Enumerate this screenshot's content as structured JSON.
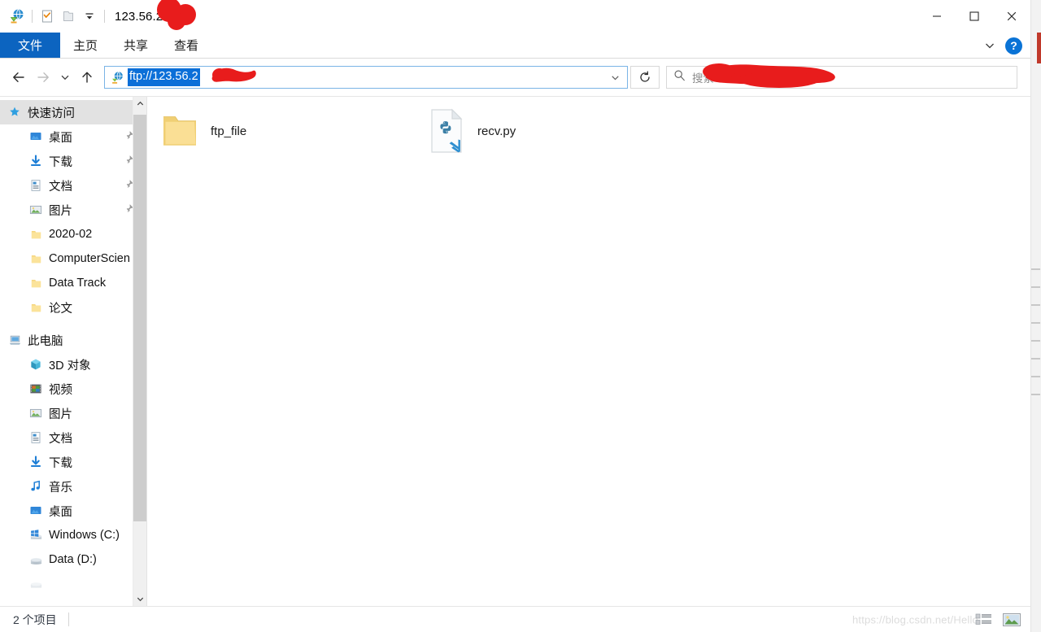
{
  "window": {
    "title": "123.56.2",
    "quick_access_toolbar": [
      {
        "name": "ftp-site-icon",
        "label": "FTP"
      },
      {
        "name": "properties-icon",
        "label": "属性"
      },
      {
        "name": "new-folder-icon",
        "label": "新建文件夹"
      },
      {
        "name": "customize-qat-chevron-icon",
        "label": "自定义快速访问工具栏"
      }
    ],
    "controls": {
      "minimize": "—",
      "maximize": "□",
      "close": "✕"
    }
  },
  "ribbon": {
    "tabs": [
      {
        "label": "文件",
        "active": true
      },
      {
        "label": "主页",
        "active": false
      },
      {
        "label": "共享",
        "active": false
      },
      {
        "label": "查看",
        "active": false
      }
    ],
    "expand_label": "展开功能区",
    "help_label": "?"
  },
  "navbar": {
    "back_label": "后退",
    "forward_label": "前进",
    "recent_label": "最近的位置",
    "up_label": "上移到",
    "address": {
      "value": "ftp://123.56.2",
      "selected": true,
      "dropdown_label": "以前的位置"
    },
    "refresh_label": "刷新",
    "search": {
      "placeholder": "搜索",
      "value": ""
    }
  },
  "sidebar": {
    "groups": [
      {
        "header": {
          "label": "快速访问",
          "icon": "star-pin-icon",
          "selected": true
        },
        "items": [
          {
            "label": "桌面",
            "icon": "desktop-icon",
            "pinned": true,
            "indent": 1
          },
          {
            "label": "下载",
            "icon": "downloads-icon",
            "pinned": true,
            "indent": 1
          },
          {
            "label": "文档",
            "icon": "documents-icon",
            "pinned": true,
            "indent": 1
          },
          {
            "label": "图片",
            "icon": "pictures-icon",
            "pinned": true,
            "indent": 1
          },
          {
            "label": "2020-02",
            "icon": "folder-icon",
            "pinned": false,
            "indent": 1
          },
          {
            "label": "ComputerScien",
            "icon": "folder-icon",
            "pinned": false,
            "indent": 1
          },
          {
            "label": "Data Track",
            "icon": "folder-icon",
            "pinned": false,
            "indent": 1
          },
          {
            "label": "论文",
            "icon": "folder-icon",
            "pinned": false,
            "indent": 1
          }
        ]
      },
      {
        "header": {
          "label": "此电脑",
          "icon": "this-pc-icon",
          "selected": false
        },
        "items": [
          {
            "label": "3D 对象",
            "icon": "3d-objects-icon",
            "pinned": false,
            "indent": 1
          },
          {
            "label": "视频",
            "icon": "videos-icon",
            "pinned": false,
            "indent": 1
          },
          {
            "label": "图片",
            "icon": "pictures-icon",
            "pinned": false,
            "indent": 1
          },
          {
            "label": "文档",
            "icon": "documents-icon",
            "pinned": false,
            "indent": 1
          },
          {
            "label": "下载",
            "icon": "downloads-icon",
            "pinned": false,
            "indent": 1
          },
          {
            "label": "音乐",
            "icon": "music-icon",
            "pinned": false,
            "indent": 1
          },
          {
            "label": "桌面",
            "icon": "desktop-icon",
            "pinned": false,
            "indent": 1
          },
          {
            "label": "Windows (C:)",
            "icon": "windows-drive-icon",
            "pinned": false,
            "indent": 1
          },
          {
            "label": "Data (D:)",
            "icon": "drive-icon",
            "pinned": false,
            "indent": 1
          }
        ]
      }
    ],
    "scroll_up_label": "向上滚动",
    "scroll_down_label": "向下滚动"
  },
  "content": {
    "items": [
      {
        "name": "ftp_file",
        "type": "folder",
        "icon": "folder-icon"
      },
      {
        "name": "recv.py",
        "type": "python-file",
        "icon": "python-vscode-file-icon"
      }
    ]
  },
  "statusbar": {
    "item_count_text": "2 个项目",
    "views": [
      {
        "name": "details-view-button",
        "label": "详细信息"
      },
      {
        "name": "large-icons-view-button",
        "label": "大图标",
        "active": true
      }
    ],
    "watermark": "https://blog.csdn.net/Hello"
  },
  "colors": {
    "accent": "#0c64c0",
    "selection": "#0b6fd8",
    "redaction": "#e81c1c",
    "folder": "#f5d57e",
    "python_blue": "#3b7fa6"
  }
}
